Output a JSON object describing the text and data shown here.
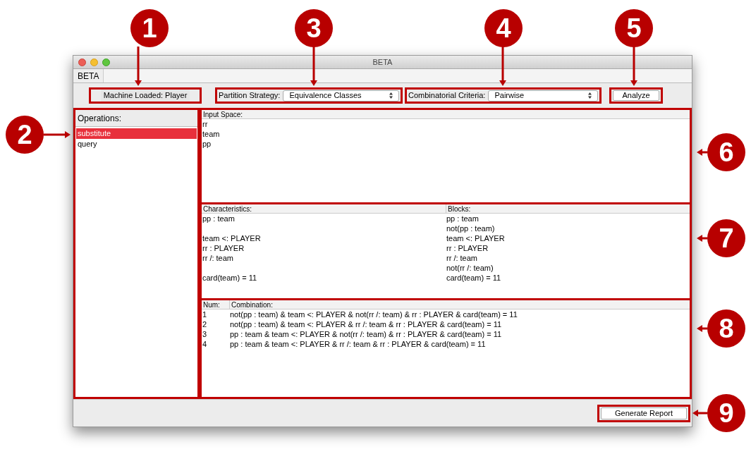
{
  "window": {
    "title": "BETA"
  },
  "menu": [
    "BETA"
  ],
  "toolbar": {
    "machine_label": "Machine Loaded: Player",
    "partition": {
      "label": "Partition Strategy:",
      "value": "Equivalence Classes"
    },
    "criteria": {
      "label": "Combinatorial Criteria:",
      "value": "Pairwise"
    },
    "analyze_button": "Analyze"
  },
  "operations": {
    "header": "Operations:",
    "items": [
      {
        "label": "substitute",
        "selected": true
      },
      {
        "label": "query",
        "selected": false
      }
    ]
  },
  "input_space": {
    "header": "Input Space:",
    "rows": [
      "rr",
      "team",
      "pp"
    ]
  },
  "characteristics": {
    "columns": [
      "Characteristics:",
      "Blocks:"
    ],
    "rows": [
      {
        "characteristic": "pp : team",
        "block": "pp : team"
      },
      {
        "block": "not(pp : team)"
      },
      {
        "characteristic": "team <: PLAYER",
        "block": "team <: PLAYER"
      },
      {
        "characteristic": "rr : PLAYER",
        "block": "rr : PLAYER"
      },
      {
        "characteristic": "rr /: team",
        "block": "rr /: team"
      },
      {
        "block": "not(rr /: team)"
      },
      {
        "characteristic": "card(team) = 11",
        "block": "card(team) = 11"
      }
    ]
  },
  "combinations": {
    "columns": [
      "Num:",
      "Combination:"
    ],
    "rows": [
      {
        "num": "1",
        "combination": "not(pp : team) & team <: PLAYER & not(rr /: team) & rr : PLAYER & card(team) = 11"
      },
      {
        "num": "2",
        "combination": "not(pp : team) & team <: PLAYER & rr /: team & rr : PLAYER & card(team) = 11"
      },
      {
        "num": "3",
        "combination": "pp : team & team <: PLAYER & not(rr /: team) & rr : PLAYER & card(team) = 11"
      },
      {
        "num": "4",
        "combination": "pp : team & team <: PLAYER & rr /: team & rr : PLAYER & card(team) = 11"
      }
    ]
  },
  "footer": {
    "report_button": "Generate Report"
  },
  "callouts": [
    "1",
    "2",
    "3",
    "4",
    "5",
    "6",
    "7",
    "8",
    "9"
  ]
}
